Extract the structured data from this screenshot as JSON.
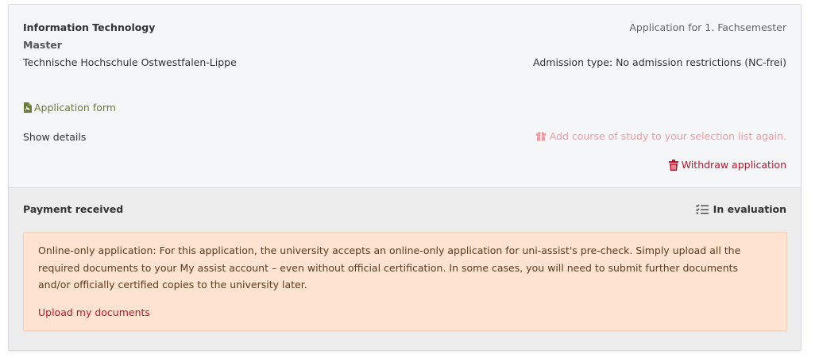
{
  "course": {
    "title": "Information Technology",
    "degree": "Master",
    "university": "Technische Hochschule Ostwestfalen-Lippe",
    "semester": "Application for 1. Fachsemester",
    "admission_type": "Admission type: No admission restrictions (NC-frei)"
  },
  "actions": {
    "application_form": "Application form",
    "show_details": "Show details",
    "add_course": "Add course of study to your selection list again.",
    "withdraw": "Withdraw application"
  },
  "status": {
    "payment": "Payment received",
    "evaluation": "In evaluation"
  },
  "notice": {
    "text": "Online-only application: For this application, the university accepts an online-only application for uni-assist's pre-check. Simply upload all the required documents to your My assist account – even without official certification. In some cases, you will need to submit further documents and/or officially certified copies to the university later.",
    "link": "Upload my documents"
  },
  "icons": {
    "application_form": "pdf-file-icon",
    "add_course": "gift-icon",
    "withdraw": "trash-icon",
    "evaluation": "checklist-icon"
  },
  "colors": {
    "link_green": "#6a7a3a",
    "danger_red": "#c0142a",
    "faded_red": "#f09aa2",
    "notice_bg": "#fde3d0"
  }
}
